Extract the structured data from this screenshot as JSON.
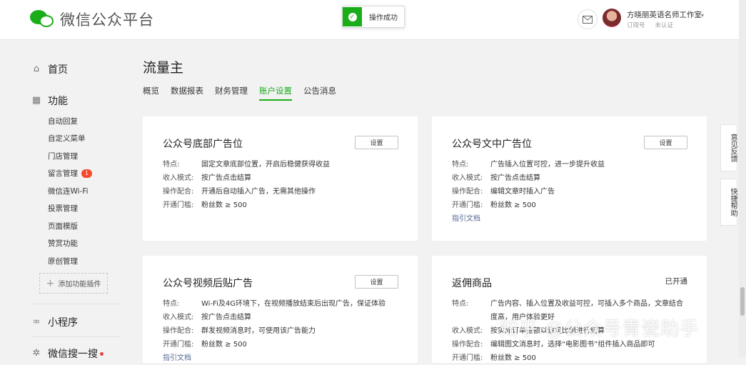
{
  "header": {
    "logo_text": "微信公众平台",
    "toast": "操作成功",
    "account_name": "方晓丽英语名师工作室",
    "account_type": "订阅号",
    "account_status": "未认证",
    "caret": "▾"
  },
  "sidebar": {
    "home": "首页",
    "features": "功能",
    "sub_items": [
      {
        "label": "自动回复"
      },
      {
        "label": "自定义菜单"
      },
      {
        "label": "门店管理"
      },
      {
        "label": "留言管理",
        "badge": "1"
      },
      {
        "label": "微信连Wi-Fi"
      },
      {
        "label": "投票管理"
      },
      {
        "label": "页面模版"
      },
      {
        "label": "赞赏功能"
      },
      {
        "label": "原创管理"
      }
    ],
    "add_plugin": "添加功能插件",
    "mini_program": "小程序",
    "search": "微信搜一搜"
  },
  "main": {
    "title": "流量主",
    "tabs": [
      "概览",
      "数据报表",
      "财务管理",
      "账户设置",
      "公告消息"
    ],
    "active_tab": "账户设置",
    "cards": [
      {
        "title": "公众号底部广告位",
        "button": "设置",
        "rows": [
          {
            "label": "特点:",
            "value": "固定文章底部位置，开启后稳健获得收益"
          },
          {
            "label": "收入模式:",
            "value": "按广告点击结算"
          },
          {
            "label": "操作配合:",
            "value": "开通后自动插入广告，无需其他操作"
          },
          {
            "label": "开通门槛:",
            "value": "粉丝数 ≥ 500"
          }
        ]
      },
      {
        "title": "公众号文中广告位",
        "button": "设置",
        "rows": [
          {
            "label": "特点:",
            "value": "广告插入位置可控，进一步提升收益"
          },
          {
            "label": "收入模式:",
            "value": "按广告点击结算"
          },
          {
            "label": "操作配合:",
            "value": "编辑文章时插入广告"
          },
          {
            "label": "开通门槛:",
            "value": "粉丝数 ≥ 500"
          }
        ],
        "link": "指引文档"
      },
      {
        "title": "公众号视频后贴广告",
        "button": "设置",
        "rows": [
          {
            "label": "特点:",
            "value": "Wi-Fi及4G环境下，在视频播放结束后出现广告，保证体验"
          },
          {
            "label": "收入模式:",
            "value": "按广告点击结算"
          },
          {
            "label": "操作配合:",
            "value": "群发视频消息时，可使用该广告能力"
          },
          {
            "label": "开通门槛:",
            "value": "粉丝数 ≥ 500"
          }
        ],
        "link": "指引文档"
      },
      {
        "title": "返佣商品",
        "status": "已开通",
        "rows": [
          {
            "label": "特点:",
            "value": "广告内容、插入位置及收益可控，可插入多个商品，文章结合度高，用户体验更好"
          },
          {
            "label": "收入模式:",
            "value": "按实际订单金额以设定比例进行结算"
          },
          {
            "label": "操作配合:",
            "value": "编辑图文消息时，选择“电影图书”组件插入商品即可"
          },
          {
            "label": "开通门槛:",
            "value": "粉丝数 ≥ 500"
          }
        ]
      }
    ]
  },
  "float": {
    "feedback": "意见反馈",
    "help": "快捷帮助"
  },
  "watermark": "知乎 @公众号青瓷助手",
  "colors": {
    "brand": "#1aad19",
    "link": "#576b95",
    "badge": "#f44a2b"
  }
}
